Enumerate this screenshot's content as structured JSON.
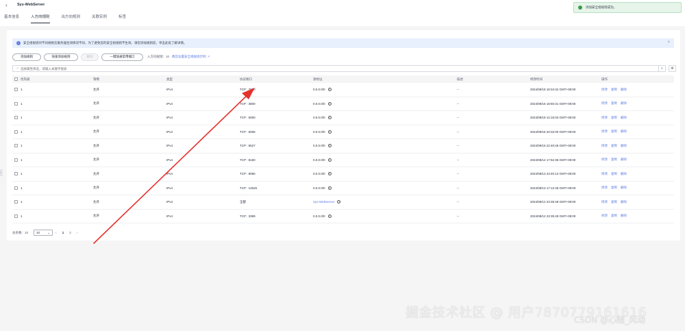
{
  "header": {
    "back_icon": "chevron-left-icon",
    "title": "Sys-WebServer",
    "tabs": [
      {
        "label": "基本信息",
        "active": false
      },
      {
        "label": "入方向规则",
        "active": true
      },
      {
        "label": "出方向规则",
        "active": false
      },
      {
        "label": "关联实例",
        "active": false
      },
      {
        "label": "标签",
        "active": false
      }
    ]
  },
  "toast": {
    "text": "添加安全组规则成功。",
    "status_color": "#3c9c4d"
  },
  "info": {
    "text": "安全组规则对不同规格云服务器生效情况不同，为了避免您的安全组规则不生效，请您添加规则前，单击此处了解详情。",
    "link": "此处"
  },
  "toolbar": {
    "add_rule": "添加规则",
    "quick_add": "快速添加规则",
    "delete": "删除",
    "open_common_ports": "一键放通常用端口",
    "rule_count_label": "入方向规则：10",
    "doc_link": "教您设置安全组规则示例"
  },
  "search": {
    "placeholder": "选择属性筛选，或输入关键字搜索"
  },
  "table": {
    "headers": [
      "优先级",
      "策略",
      "类型",
      "协议端口",
      "源地址",
      "描述",
      "修改时间",
      "操作"
    ],
    "rows": [
      {
        "priority": "1",
        "policy": "允许",
        "type": "IPv4",
        "port": "TCP : 7860",
        "source": "0.0.0.0/0",
        "source_is_link": false,
        "desc": "--",
        "time": "2024/09/19 18:34:42 GMT+08:00"
      },
      {
        "priority": "1",
        "policy": "允许",
        "type": "IPv4",
        "port": "TCP : 3800",
        "source": "0.0.0.0/0",
        "source_is_link": false,
        "desc": "--",
        "time": "2024/09/16 18:50:31 GMT+08:00"
      },
      {
        "priority": "1",
        "policy": "允许",
        "type": "IPv4",
        "port": "TCP : 5000",
        "source": "0.0.0.0/0",
        "source_is_link": false,
        "desc": "--",
        "time": "2024/09/19 12:15:03 GMT+08:00"
      },
      {
        "priority": "1",
        "policy": "允许",
        "type": "IPv4",
        "port": "TCP : 6006",
        "source": "0.0.0.0/0",
        "source_is_link": false,
        "desc": "--",
        "time": "2024/09/16 20:32:00 GMT+08:00"
      },
      {
        "priority": "1",
        "policy": "允许",
        "type": "IPv4",
        "port": "TCP : 5527",
        "source": "0.0.0.0/0",
        "source_is_link": false,
        "desc": "--",
        "time": "2024/09/16 22:40:46 GMT+08:00"
      },
      {
        "priority": "1",
        "policy": "允许",
        "type": "IPv4",
        "port": "TCP : 8180",
        "source": "0.0.0.0/0",
        "source_is_link": false,
        "desc": "--",
        "time": "2024/08/14 17:52:35 GMT+08:00"
      },
      {
        "priority": "1",
        "policy": "允许",
        "type": "IPv4",
        "port": "TCP : 8080",
        "source": "0.0.0.0/0",
        "source_is_link": false,
        "desc": "--",
        "time": "2024/08/13 23:40:13 GMT+08:00"
      },
      {
        "priority": "1",
        "policy": "允许",
        "type": "IPv4",
        "port": "TCP : 14525",
        "source": "0.0.0.0/0",
        "source_is_link": false,
        "desc": "--",
        "time": "2024/08/13 17:12:48 GMT+08:00"
      },
      {
        "priority": "1",
        "policy": "允许",
        "type": "IPv4",
        "port": "全部",
        "source": "Sys-WebServer",
        "source_is_link": true,
        "desc": "--",
        "time": "2024/08/12 23:35:48 GMT+08:00"
      },
      {
        "priority": "1",
        "policy": "允许",
        "type": "IPv4",
        "port": "TCP : 3389",
        "source": "0.0.0.0/0",
        "source_is_link": false,
        "desc": "--",
        "time": "2024/08/12 23:35:48 GMT+08:00"
      }
    ],
    "ops": [
      "修改",
      "复制",
      "删除"
    ]
  },
  "pager": {
    "total_label": "总条数：10",
    "page_size": "10",
    "pages": [
      "1",
      "2"
    ],
    "current": "1"
  },
  "watermark": {
    "main": "掘金技术社区 @ 用户7870779161616",
    "sub": "CSDN @心随_风动"
  },
  "accent_color": "#5e7ce0",
  "annotation_color": "#e5322d"
}
